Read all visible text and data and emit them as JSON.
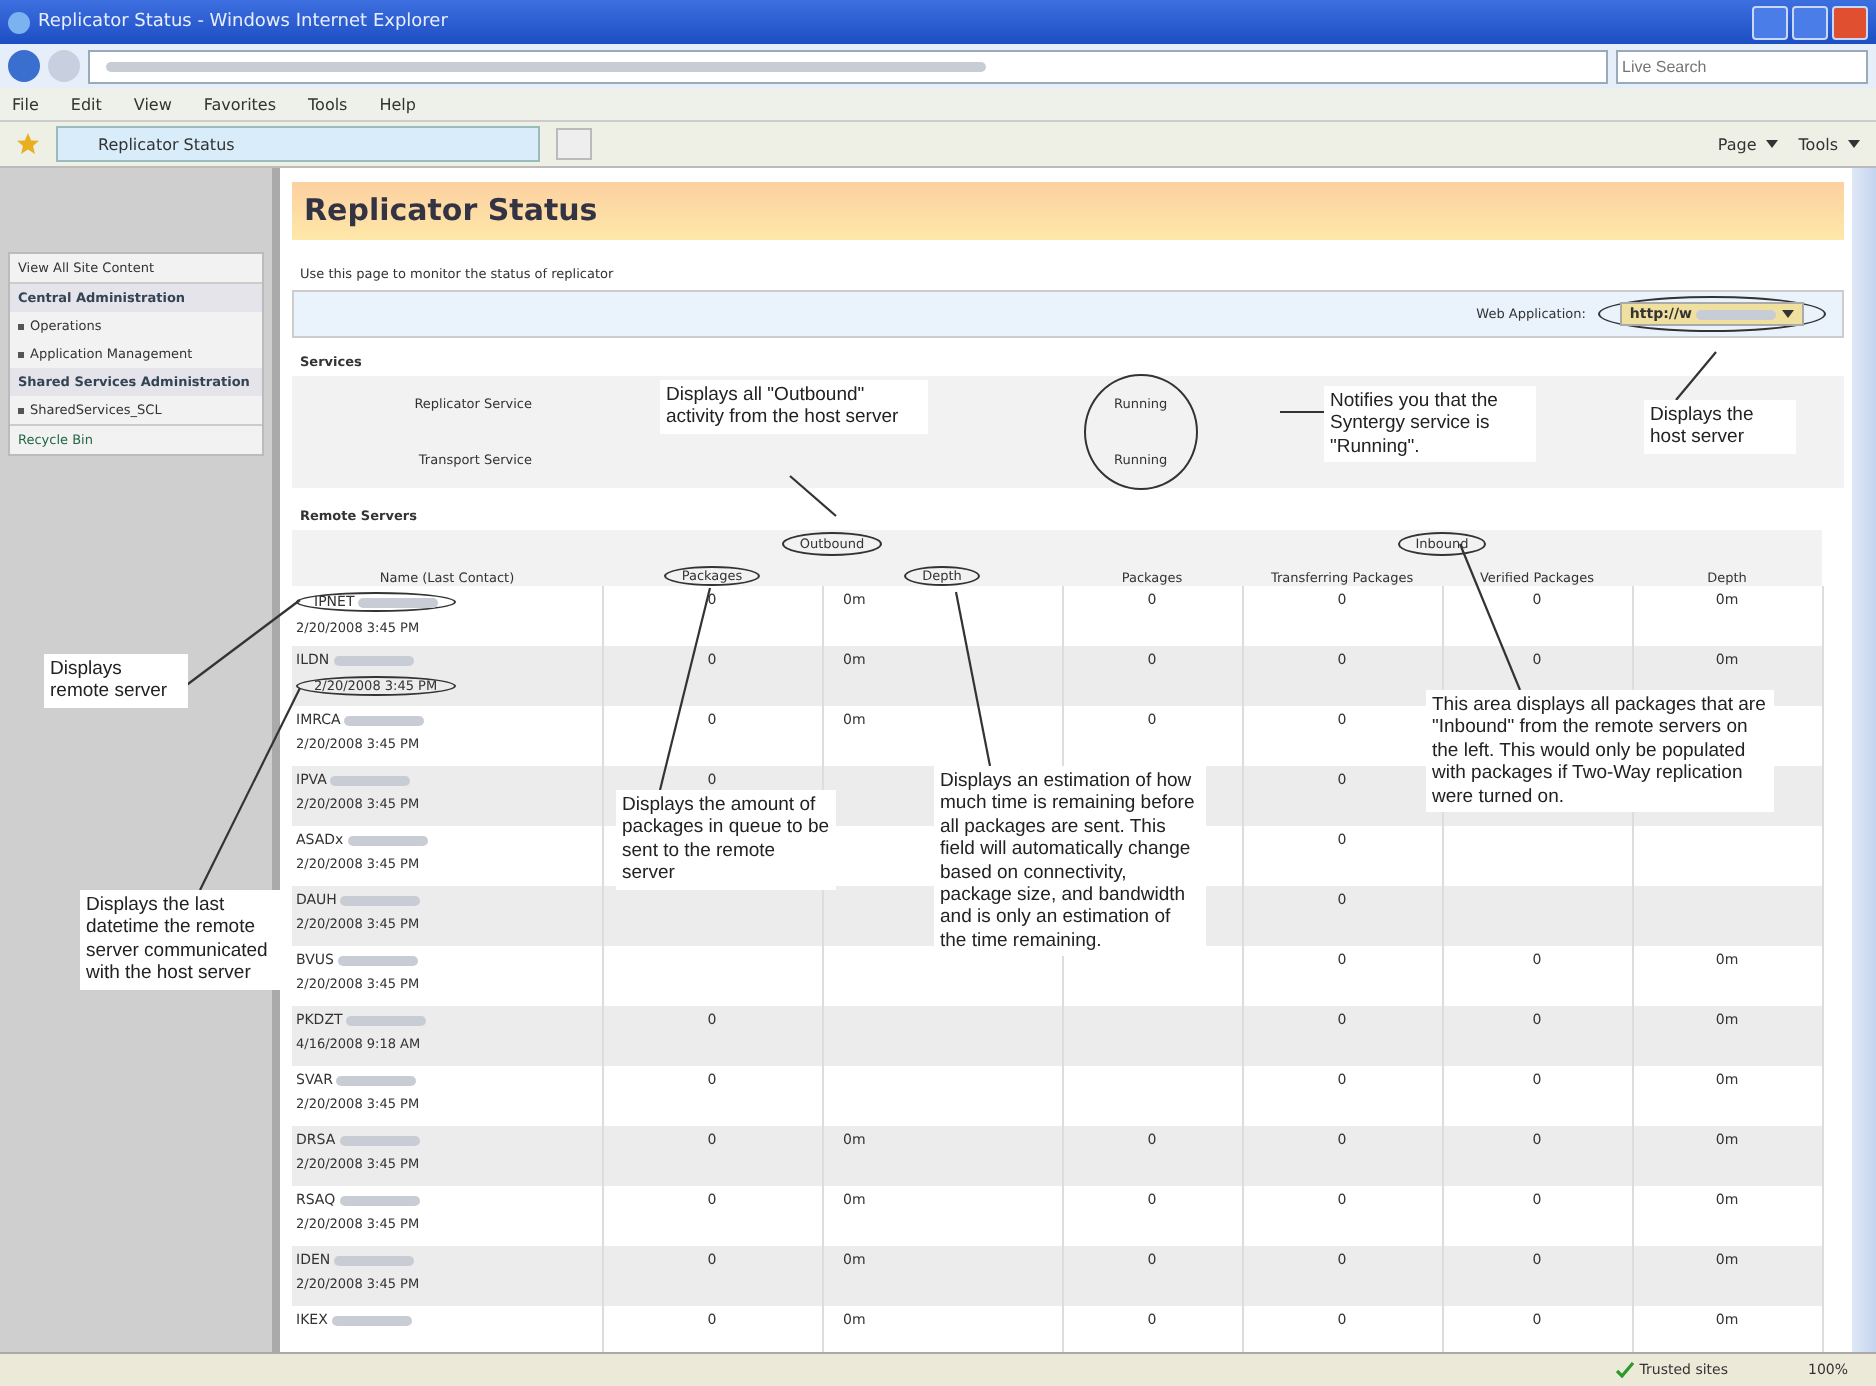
{
  "window": {
    "title": "Replicator Status - Windows Internet Explorer"
  },
  "search": {
    "placeholder": "Live Search"
  },
  "menu": [
    "File",
    "Edit",
    "View",
    "Favorites",
    "Tools",
    "Help"
  ],
  "tab": {
    "label": "Replicator Status"
  },
  "toolbar": [
    "Page",
    "Tools"
  ],
  "sidebar": {
    "top_link": "View All Site Content",
    "sections": [
      {
        "heading": "Central Administration",
        "items": [
          "Operations",
          "Application Management"
        ]
      },
      {
        "heading": "Shared Services Administration",
        "items": [
          "SharedServices_SCL"
        ]
      }
    ],
    "recycle": "Recycle Bin"
  },
  "page": {
    "title": "Replicator Status",
    "description": "Use this page to monitor the status of replicator",
    "web_app": {
      "label": "Web Application:",
      "value": "http://w",
      "circled": true
    }
  },
  "services": {
    "heading": "Services",
    "status_circled": true,
    "rows": [
      {
        "name": "Replicator Service",
        "status": "Running"
      },
      {
        "name": "Transport Service",
        "status": "Running"
      }
    ]
  },
  "remote": {
    "heading": "Remote Servers",
    "groups": [
      {
        "label": "Outbound",
        "circled": true
      },
      {
        "label": "Inbound",
        "circled": true
      }
    ],
    "name_column": "Name (Last Contact)",
    "columns": [
      {
        "label": "Packages",
        "circled": true
      },
      {
        "label": "Depth",
        "circled": true
      },
      {
        "label": "Packages",
        "circled": false
      },
      {
        "label": "Transferring Packages",
        "circled": false
      },
      {
        "label": "Verified Packages",
        "circled": false
      },
      {
        "label": "Depth",
        "circled": false
      }
    ],
    "rows": [
      {
        "name": "IPNET",
        "date": "2/20/2008 3:45 PM",
        "name_circled": true,
        "date_circled": false,
        "cells": [
          "0",
          "0m",
          "0",
          "0",
          "0",
          "0m"
        ]
      },
      {
        "name": "ILDN",
        "date": "2/20/2008 3:45 PM",
        "name_circled": false,
        "date_circled": true,
        "cells": [
          "0",
          "0m",
          "0",
          "0",
          "0",
          "0m"
        ]
      },
      {
        "name": "IMRCA",
        "date": "2/20/2008 3:45 PM",
        "name_circled": false,
        "date_circled": false,
        "cells": [
          "0",
          "0m",
          "0",
          "0",
          null,
          null
        ]
      },
      {
        "name": "IPVA",
        "date": "2/20/2008 3:45 PM",
        "name_circled": false,
        "date_circled": false,
        "cells": [
          "0",
          null,
          null,
          "0",
          null,
          null
        ]
      },
      {
        "name": "ASADx",
        "date": "2/20/2008 3:45 PM",
        "name_circled": false,
        "date_circled": false,
        "cells": [
          null,
          null,
          null,
          "0",
          null,
          null
        ]
      },
      {
        "name": "DAUH",
        "date": "2/20/2008 3:45 PM",
        "name_circled": false,
        "date_circled": false,
        "cells": [
          null,
          null,
          null,
          "0",
          null,
          null
        ]
      },
      {
        "name": "BVUS",
        "date": "2/20/2008 3:45 PM",
        "name_circled": false,
        "date_circled": false,
        "cells": [
          null,
          null,
          null,
          "0",
          "0",
          "0m"
        ]
      },
      {
        "name": "PKDZT",
        "date": "4/16/2008 9:18 AM",
        "name_circled": false,
        "date_circled": false,
        "cells": [
          "0",
          null,
          null,
          "0",
          "0",
          "0m"
        ]
      },
      {
        "name": "SVAR",
        "date": "2/20/2008 3:45 PM",
        "name_circled": false,
        "date_circled": false,
        "cells": [
          "0",
          null,
          null,
          "0",
          "0",
          "0m"
        ]
      },
      {
        "name": "DRSA",
        "date": "2/20/2008 3:45 PM",
        "name_circled": false,
        "date_circled": false,
        "cells": [
          "0",
          "0m",
          "0",
          "0",
          "0",
          "0m"
        ]
      },
      {
        "name": "RSAQ",
        "date": "2/20/2008 3:45 PM",
        "name_circled": false,
        "date_circled": false,
        "cells": [
          "0",
          "0m",
          "0",
          "0",
          "0",
          "0m"
        ]
      },
      {
        "name": "IDEN",
        "date": "2/20/2008 3:45 PM",
        "name_circled": false,
        "date_circled": false,
        "cells": [
          "0",
          "0m",
          "0",
          "0",
          "0",
          "0m"
        ]
      },
      {
        "name": "IKEX",
        "name_circled": false,
        "cells": [
          "0",
          "0m",
          "0",
          "0",
          "0",
          "0m"
        ]
      }
    ]
  },
  "callouts": [
    "Displays all \"Outbound\" activity from the host server",
    "Notifies you that the Syntergy service is \"Running\".",
    "Displays the host server",
    "Displays remote server",
    "Displays the last datetime the remote server communicated with the host server",
    "Displays the amount of packages in queue to be sent to the remote server",
    "Displays an estimation of how much time is remaining before all packages are sent. This field will automatically change based on connectivity, package size, and bandwidth and is only an estimation of the time remaining.",
    "This area displays all packages that are \"Inbound\" from the remote servers on the left. This would only be populated with packages if Two-Way replication were turned on."
  ],
  "status_bar": {
    "zone": "Trusted sites",
    "zoom": "100%"
  }
}
